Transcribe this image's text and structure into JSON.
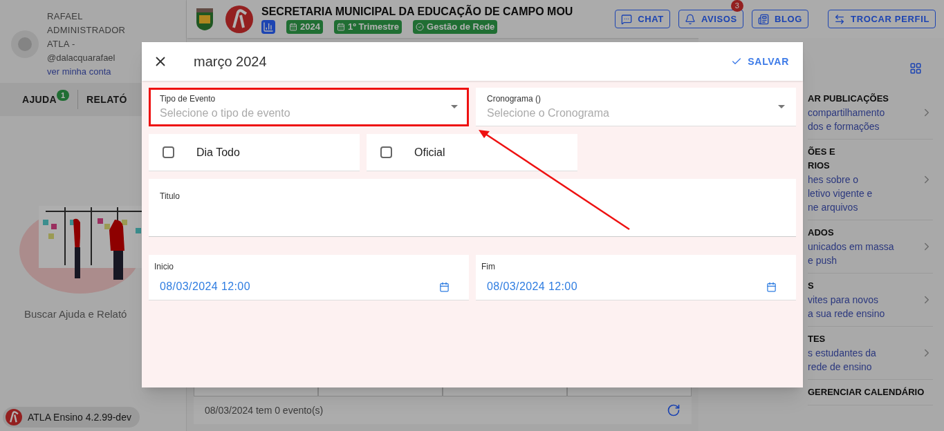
{
  "user": {
    "name": "RAFAEL ADMINISTRADOR ATLA -",
    "handle": "@dalacquarafael",
    "account_link": "ver minha conta"
  },
  "sidebar_tabs": [
    {
      "label": "AJUDA",
      "badge": "1"
    },
    {
      "label": "RELATÓ"
    }
  ],
  "sidebar_caption": "Buscar Ajuda e Relató",
  "version": "ATLA Ensino 4.2.99-dev",
  "header": {
    "title": "SECRETARIA MUNICIPAL DA EDUCAÇÃO DE CAMPO MOU",
    "chips": [
      "2024",
      "1º Trimestre",
      "Gestão de Rede"
    ]
  },
  "header_buttons": [
    {
      "kind": "chat",
      "label": "CHAT"
    },
    {
      "kind": "bell",
      "label": "AVISOS",
      "badge": "3"
    },
    {
      "kind": "news",
      "label": "BLOG"
    },
    {
      "kind": "swap",
      "label": "TROCAR PERFIL"
    }
  ],
  "right_panel": [
    {
      "title": [
        "AR PUBLICAÇÕES"
      ],
      "lines": [
        "compartilhamento",
        "dos e formações"
      ]
    },
    {
      "title": [
        "ÕES E",
        "RIOS"
      ],
      "lines": [
        "hes sobre o",
        "letivo vigente e",
        "ne arquivos"
      ]
    },
    {
      "title": [
        "ADOS"
      ],
      "lines": [
        "unicados em massa",
        "e push"
      ]
    },
    {
      "title": [
        "S"
      ],
      "lines": [
        "vites para novos",
        "a sua rede ensino"
      ]
    },
    {
      "title": [
        "TES"
      ],
      "lines": [
        "s estudantes da",
        "rede de ensino"
      ]
    },
    {
      "title": [
        "GERENCIAR CALENDÁRIO"
      ]
    }
  ],
  "calendar_footer": "08/03/2024 tem 0 evento(s)",
  "modal": {
    "title": "março 2024",
    "save": "SALVAR",
    "selects": [
      {
        "label": "Tipo de Evento",
        "placeholder": "Selecione o tipo de evento",
        "highlighted": true
      },
      {
        "label": "Cronograma ()",
        "placeholder": "Selecione o Cronograma",
        "highlighted": false
      }
    ],
    "checkboxes": [
      {
        "label": "Dia Todo",
        "checked": false
      },
      {
        "label": "Oficial",
        "checked": false
      }
    ],
    "title_field": {
      "label": "Titulo"
    },
    "dates": [
      {
        "label": "Inicio",
        "value": "08/03/2024 12:00"
      },
      {
        "label": "Fim",
        "value": "08/03/2024 12:00"
      }
    ]
  }
}
